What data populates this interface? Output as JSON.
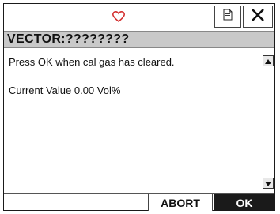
{
  "header": {
    "status_icon": "heart-outline-icon",
    "status_color": "#d32f2f",
    "document_icon": "document-icon",
    "close_icon": "close-icon"
  },
  "title": "VECTOR:????????",
  "content": {
    "line1": "Press OK when cal gas has cleared.",
    "line2": "Current Value 0.00 Vol%"
  },
  "scrollbar": {
    "up_icon": "triangle-up-icon",
    "down_icon": "triangle-down-icon"
  },
  "buttons": {
    "abort": "ABORT",
    "ok": "OK"
  }
}
